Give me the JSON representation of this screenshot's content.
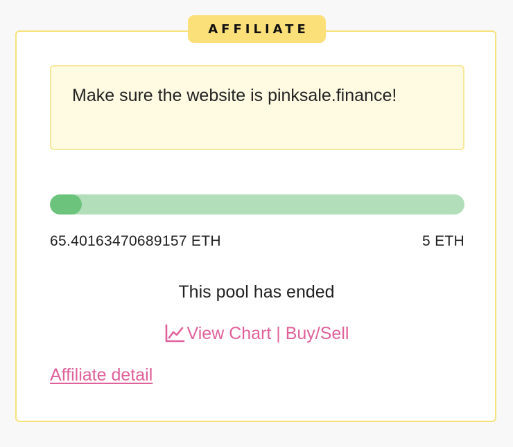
{
  "badge": {
    "label": "AFFILIATE"
  },
  "notice": {
    "text": "Make sure the website is pinksale.finance!"
  },
  "progress": {
    "raised_label": "65.40163470689157 ETH",
    "cap_label": "5 ETH",
    "fill_fraction": 0.077,
    "track_color": "#b2dfb9",
    "fill_color": "#6cc47c"
  },
  "status": {
    "text": "This pool has ended"
  },
  "chart_link": {
    "icon": "line-chart-icon",
    "text": "View Chart | Buy/Sell"
  },
  "affiliate_link": {
    "text": "Affiliate detail"
  },
  "colors": {
    "accent_pink": "#e0609a",
    "badge_yellow": "#fbe07a",
    "border_yellow": "#f6e27c"
  }
}
